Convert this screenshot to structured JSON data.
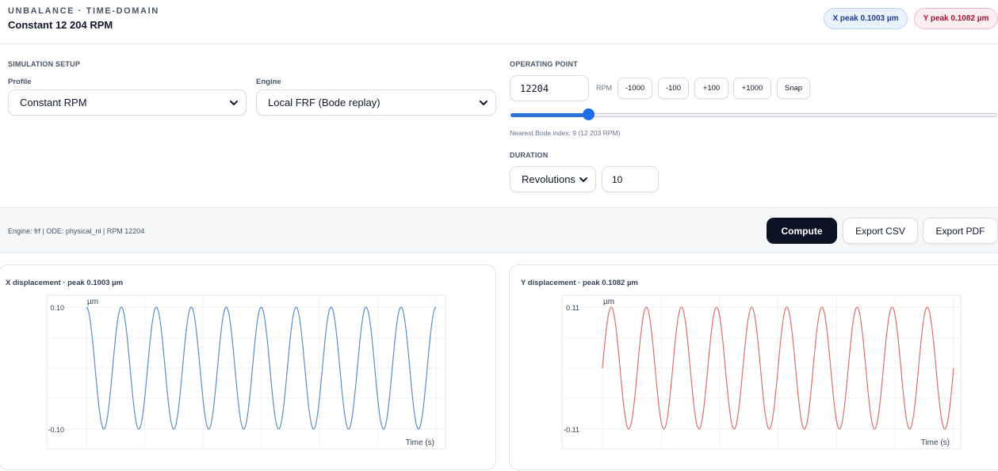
{
  "header": {
    "eyebrow": "UNBALANCE · TIME-DOMAIN",
    "title": "Constant 12 204 RPM",
    "x_peak_badge": "X peak 0.1003 µm",
    "y_peak_badge": "Y peak 0.1082 µm",
    "colors": {
      "x_badge": "#1e3a8a",
      "y_badge": "#9f1239"
    }
  },
  "setup": {
    "section_label": "SIMULATION SETUP",
    "profile_label": "Profile",
    "profile_value": "Constant RPM",
    "engine_label": "Engine",
    "engine_value": "Local FRF (Bode replay)"
  },
  "operating_point": {
    "section_label": "OPERATING POINT",
    "rpm_value": "12204",
    "rpm_unit": "RPM",
    "step_buttons": [
      "-1000",
      "-100",
      "+100",
      "+1000"
    ],
    "snap_label": "Snap",
    "slider_fraction": 0.16,
    "hint": "Nearest Bode index: 9 (12 203 RPM)"
  },
  "duration": {
    "section_label": "DURATION",
    "mode_value": "Revolutions",
    "count_value": "10"
  },
  "actions": {
    "status": "Engine: frf | ODE: physical_nl | RPM 12204",
    "compute_label": "Compute",
    "export_csv_label": "Export CSV",
    "export_pdf_label": "Export PDF"
  },
  "chart_data": [
    {
      "type": "line",
      "title": "X displacement · peak 0.1003 µm",
      "ylabel": "µm",
      "xlabel": "Time (s)",
      "y_ticks": [
        "0.10",
        "-0.10"
      ],
      "ylim": [
        -0.1003,
        0.1003
      ],
      "cycles": 10,
      "phase_deg": 90,
      "amplitude": 0.1003,
      "grid": true,
      "series": [
        {
          "color": "#5b8ec9"
        }
      ]
    },
    {
      "type": "line",
      "title": "Y displacement · peak 0.1082 µm",
      "ylabel": "µm",
      "xlabel": "Time (s)",
      "y_ticks": [
        "0.11",
        "-0.11"
      ],
      "ylim": [
        -0.1082,
        0.1082
      ],
      "cycles": 10,
      "phase_deg": 0,
      "amplitude": 0.1082,
      "grid": true,
      "series": [
        {
          "color": "#d9716f"
        }
      ]
    }
  ]
}
